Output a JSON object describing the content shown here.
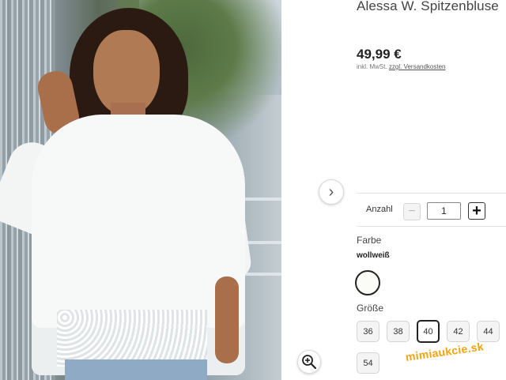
{
  "product": {
    "title": "Alessa W. Spitzenbluse",
    "price": "49,99 €",
    "vat_prefix": "inkl. MwSt.",
    "vat_link": "zzgl. Versandkosten"
  },
  "gallery": {
    "next_icon": "chevron-right-icon",
    "next_glyph": "›",
    "zoom_icon": "zoom-in-icon"
  },
  "quantity": {
    "label": "Anzahl",
    "minus_glyph": "−",
    "value": "1",
    "plus_glyph": "+"
  },
  "color": {
    "label": "Farbe",
    "selected_name": "wollweiß",
    "swatch_color": "#fbfbf7"
  },
  "size": {
    "label": "Größe",
    "options": [
      "36",
      "38",
      "40",
      "42",
      "44",
      "54"
    ],
    "selected": "40"
  },
  "watermark": "mimiaukcie.sk",
  "colors": {
    "watermark": "#f3a40d",
    "selected_border": "#222222"
  }
}
